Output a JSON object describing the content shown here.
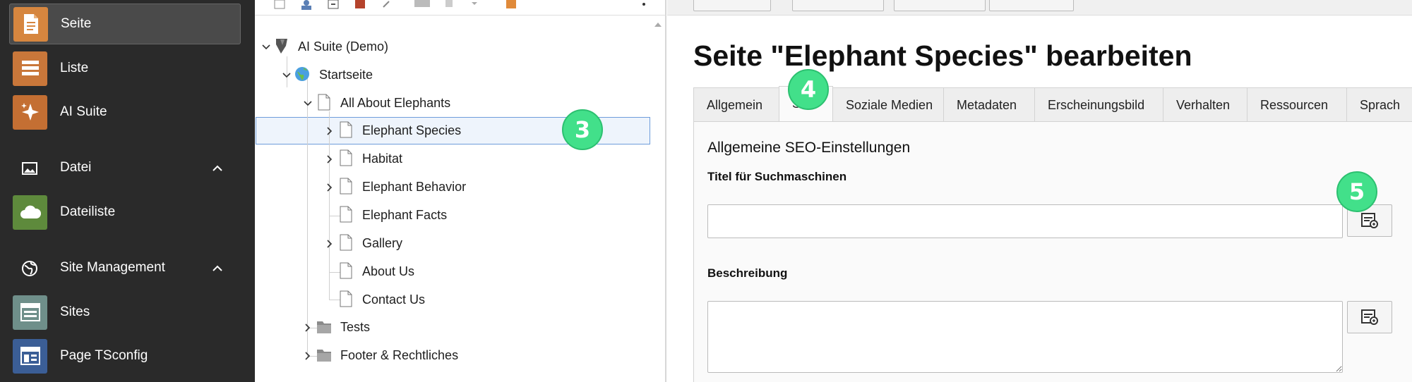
{
  "module_menu": {
    "items": [
      {
        "label": "Seite",
        "icon": "page-icon",
        "active": true
      },
      {
        "label": "Liste",
        "icon": "list-icon"
      },
      {
        "label": "AI Suite",
        "icon": "sparkle-icon"
      }
    ],
    "groups": [
      {
        "label": "Datei",
        "icon": "image-icon",
        "items": [
          {
            "label": "Dateiliste",
            "icon": "cloud-icon"
          }
        ]
      },
      {
        "label": "Site Management",
        "icon": "globe-icon",
        "items": [
          {
            "label": "Sites",
            "icon": "sites-icon"
          },
          {
            "label": "Page TSconfig",
            "icon": "tsconfig-icon"
          }
        ]
      }
    ]
  },
  "page_tree": {
    "root": "AI Suite (Demo)",
    "start": "Startseite",
    "parent": "All About Elephants",
    "children": [
      "Elephant Species",
      "Habitat",
      "Elephant Behavior",
      "Elephant Facts",
      "Gallery",
      "About Us",
      "Contact Us"
    ],
    "siblings": [
      "Tests",
      "Footer & Rechtliches"
    ],
    "selected": "Elephant Species"
  },
  "content": {
    "title": "Seite \"Elephant Species\" bearbeiten",
    "tabs": [
      "Allgemein",
      "SEO",
      "Soziale Medien",
      "Metadaten",
      "Erscheinungsbild",
      "Verhalten",
      "Ressourcen",
      "Sprach"
    ],
    "active_tab": "SEO",
    "section_title": "Allgemeine SEO-Einstellungen",
    "fields": {
      "seo_title_label": "Titel für Suchmaschinen",
      "seo_title_value": "",
      "description_label": "Beschreibung",
      "description_value": ""
    }
  },
  "markers": {
    "tree": "3",
    "tab": "4",
    "field": "5"
  },
  "colors": {
    "marker": "#42e08a",
    "selected_row": "#eef4fc",
    "selected_border": "#6d9cdb",
    "menu_bg": "#2a2a2a"
  }
}
